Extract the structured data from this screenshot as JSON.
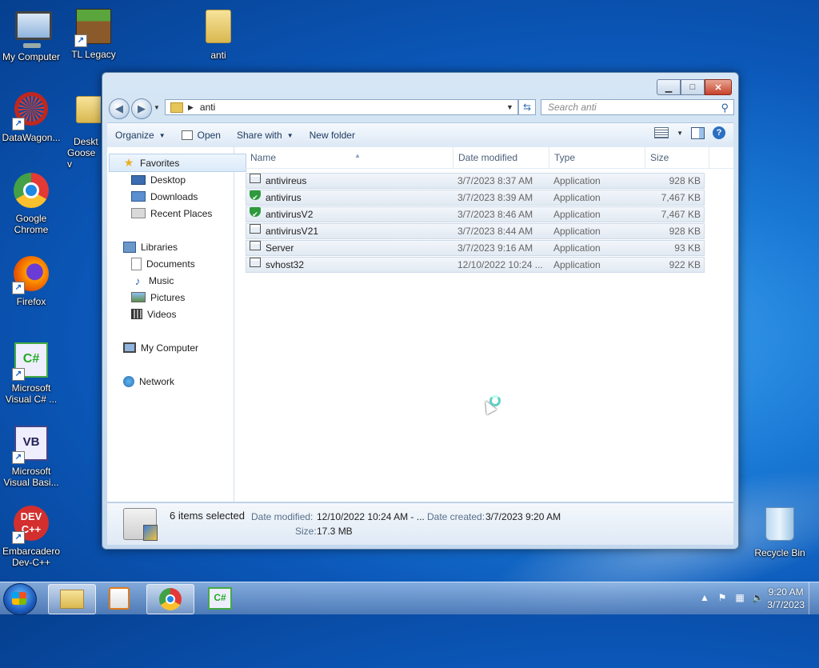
{
  "desktop": {
    "icons": {
      "my_computer": "My Computer",
      "tl_legacy": "TL Legacy",
      "anti": "anti",
      "datawagon": "DataWagon...",
      "desktop_goose_1": "Deskt",
      "desktop_goose_2": "Goose v",
      "chrome_1": "Google",
      "chrome_2": "Chrome",
      "firefox": "Firefox",
      "vcs_1": "Microsoft",
      "vcs_2": "Visual C# ...",
      "vb_1": "Microsoft",
      "vb_2": "Visual Basi...",
      "devcpp_1": "Embarcadero",
      "devcpp_2": "Dev-C++",
      "recycle_bin": "Recycle Bin"
    }
  },
  "window": {
    "address": {
      "path": "anti"
    },
    "search": {
      "placeholder": "Search anti"
    },
    "toolbar": {
      "organize": "Organize",
      "open": "Open",
      "share_with": "Share with",
      "new_folder": "New folder"
    },
    "nav": {
      "favorites": "Favorites",
      "desktop": "Desktop",
      "downloads": "Downloads",
      "recent_places": "Recent Places",
      "libraries": "Libraries",
      "documents": "Documents",
      "music": "Music",
      "pictures": "Pictures",
      "videos": "Videos",
      "my_computer": "My Computer",
      "network": "Network"
    },
    "columns": {
      "name": "Name",
      "date_modified": "Date modified",
      "type": "Type",
      "size": "Size"
    },
    "files": [
      {
        "name": "antivireus",
        "date": "3/7/2023 8:37 AM",
        "type": "Application",
        "size": "928 KB",
        "icon": "app-icon"
      },
      {
        "name": "antivirus",
        "date": "3/7/2023 8:39 AM",
        "type": "Application",
        "size": "7,467 KB",
        "icon": "shield-icon"
      },
      {
        "name": "antivirusV2",
        "date": "3/7/2023 8:46 AM",
        "type": "Application",
        "size": "7,467 KB",
        "icon": "shield-icon"
      },
      {
        "name": "antivirusV21",
        "date": "3/7/2023 8:44 AM",
        "type": "Application",
        "size": "928 KB",
        "icon": "app-icon"
      },
      {
        "name": "Server",
        "date": "3/7/2023 9:16 AM",
        "type": "Application",
        "size": "93 KB",
        "icon": "app-icon"
      },
      {
        "name": "svhost32",
        "date": "12/10/2022 10:24 ...",
        "type": "Application",
        "size": "922 KB",
        "icon": "app-icon"
      }
    ],
    "details": {
      "count": "6 items selected",
      "date_modified_label": "Date modified:",
      "date_modified_value": "12/10/2022 10:24 AM - ...",
      "date_created_label": "Date created:",
      "date_created_value": "3/7/2023 9:20 AM",
      "size_label": "Size:",
      "size_value": "17.3 MB"
    }
  },
  "taskbar": {
    "clock_time": "9:20 AM",
    "clock_date": "3/7/2023",
    "cs_label": "C#"
  }
}
